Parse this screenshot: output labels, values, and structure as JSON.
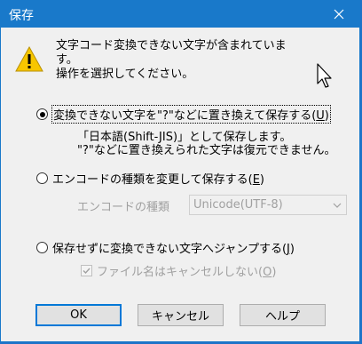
{
  "window": {
    "title": "保存"
  },
  "message": {
    "line1": "文字コード変換できない文字が含まれていま",
    "line2": "す。",
    "line3": "操作を選択してください。"
  },
  "options": {
    "replace": {
      "label": "変換できない文字を\"?\"などに置き換えて保存する(",
      "key": "U",
      "suffix": ")",
      "checked": true
    },
    "replace_note": {
      "line1": "「日本語(Shift-JIS)」として保存します。",
      "line2": "\"?\"などに置き換えられた文字は復元できません。"
    },
    "change_encoding": {
      "label": "エンコードの種類を変更して保存する(",
      "key": "E",
      "suffix": ")",
      "checked": false
    },
    "encoding": {
      "label": "エンコードの種類",
      "selected": "Unicode(UTF-8)"
    },
    "jump": {
      "label": "保存せずに変換できない文字へジャンプする(",
      "key": "J",
      "suffix": ")",
      "checked": false
    },
    "no_cancel": {
      "label": "ファイル名はキャンセルしない(",
      "key": "O",
      "suffix": ")",
      "checked": true
    }
  },
  "buttons": {
    "ok": "OK",
    "cancel": "キャンセル",
    "help": "ヘルプ"
  },
  "icons": {
    "warning": "warning-icon",
    "close": "close-icon",
    "cursor": "mouse-cursor-icon"
  },
  "colors": {
    "titlebar": "#1979ca",
    "accent": "#0078d7"
  }
}
